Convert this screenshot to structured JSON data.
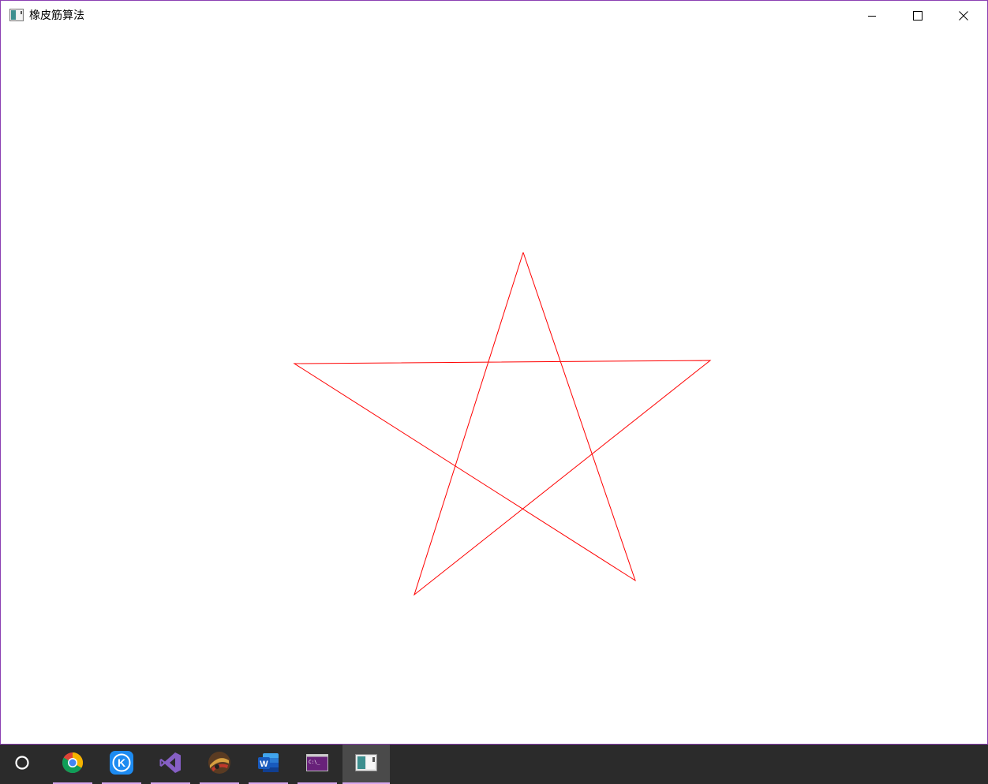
{
  "window": {
    "title": "橡皮筋算法",
    "border_color": "#8b3fb2",
    "app_icon": "app-window-icon",
    "controls": {
      "minimize_icon": "minimize-icon",
      "maximize_icon": "maximize-icon",
      "close_icon": "close-icon"
    }
  },
  "drawing": {
    "shape": "five-pointed star",
    "stroke_color": "#ff0000"
  },
  "taskbar": {
    "background": "#2b2b2b",
    "indicator_color": "#d7a6ee",
    "items": [
      {
        "icon": "cortana-search-icon",
        "running": false,
        "active": false
      },
      {
        "icon": "chrome-icon",
        "running": true,
        "active": false
      },
      {
        "icon": "kugou-music-icon",
        "running": true,
        "active": false
      },
      {
        "icon": "visual-studio-icon",
        "running": true,
        "active": false
      },
      {
        "icon": "game-app-icon",
        "running": true,
        "active": false
      },
      {
        "icon": "word-icon",
        "running": true,
        "active": false
      },
      {
        "icon": "console-icon",
        "running": true,
        "active": false
      },
      {
        "icon": "app-window-icon",
        "running": true,
        "active": true
      }
    ]
  }
}
